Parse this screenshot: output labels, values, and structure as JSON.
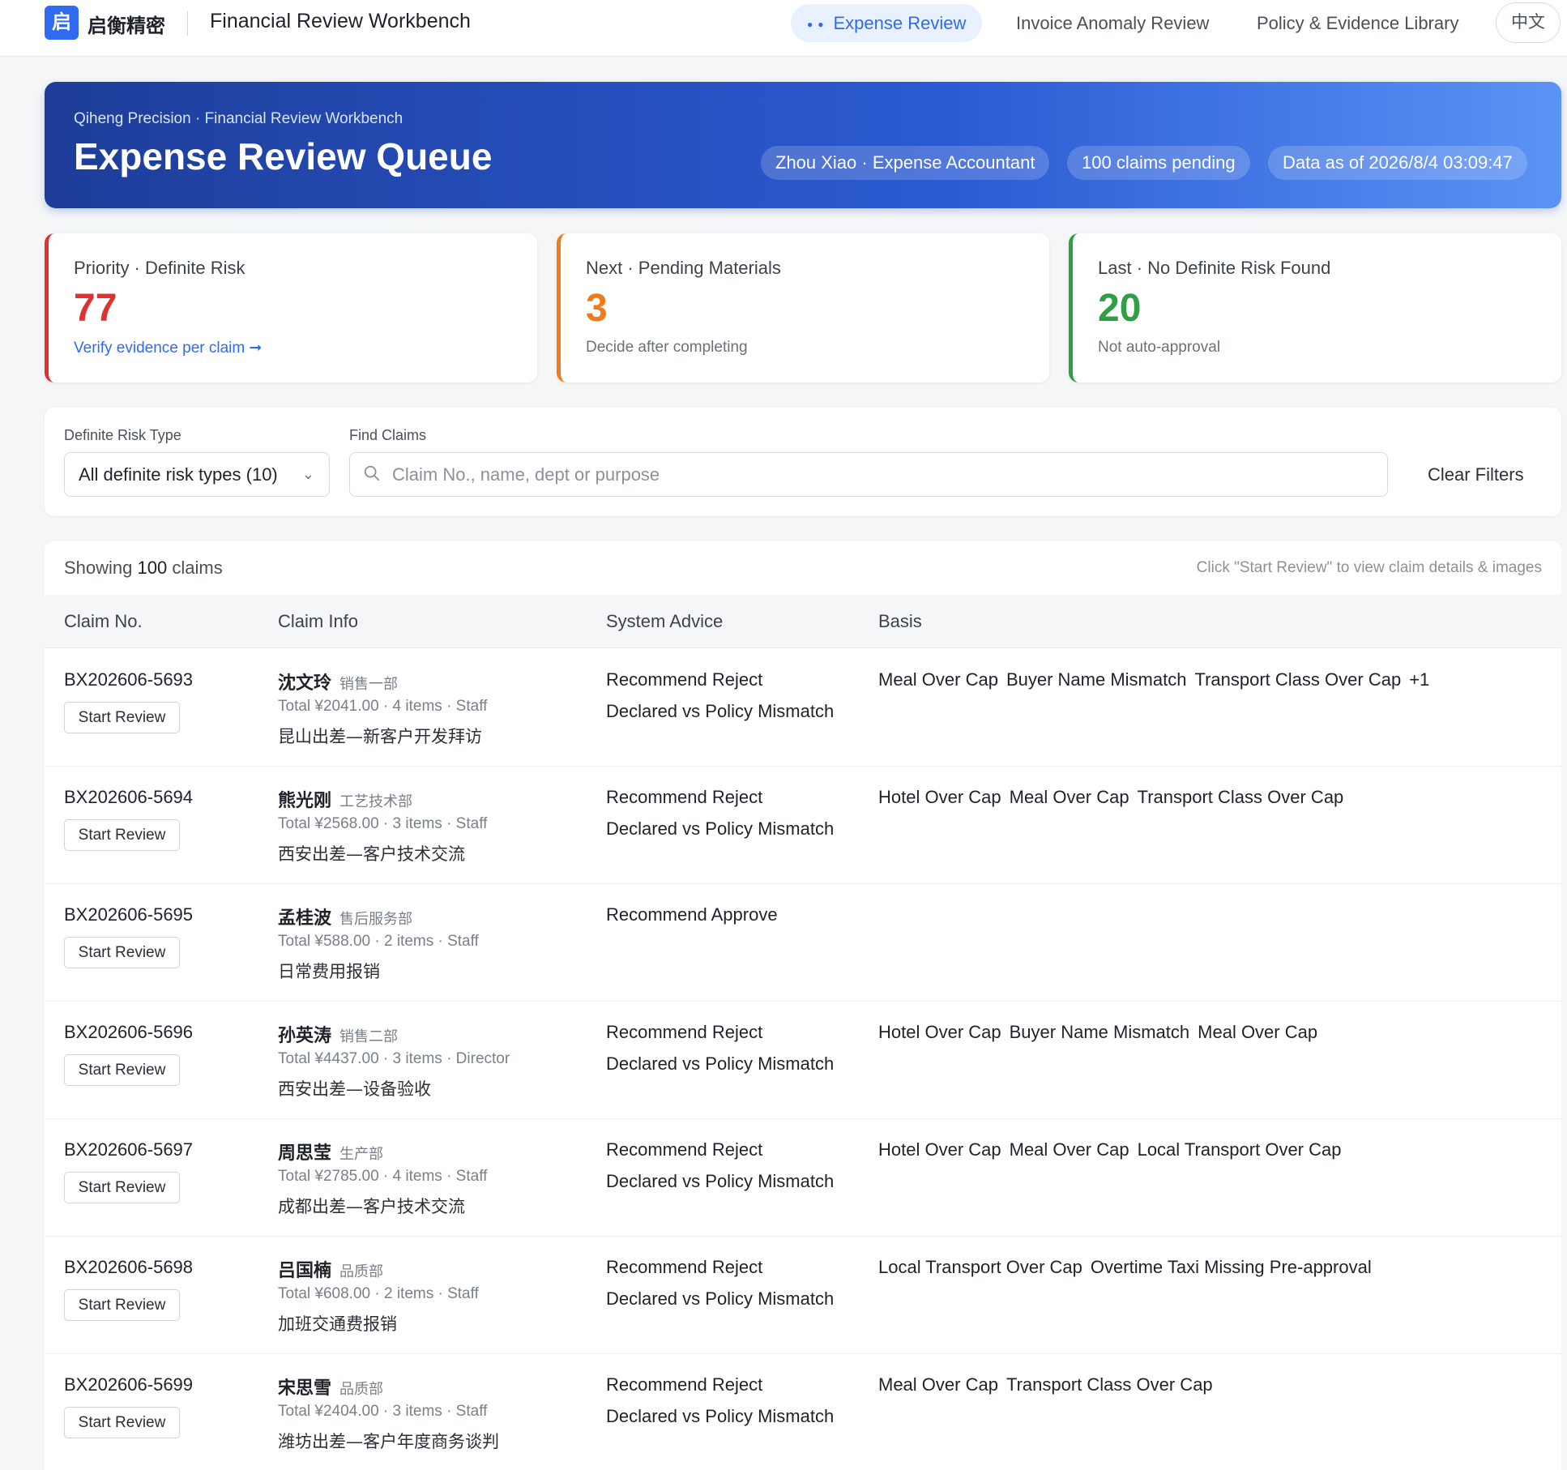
{
  "topbar": {
    "logo_char": "启",
    "brand": "启衡精密",
    "app_title": "Financial Review Workbench",
    "tabs": [
      {
        "label": "Expense Review",
        "active": true
      },
      {
        "label": "Invoice Anomaly Review",
        "active": false
      },
      {
        "label": "Policy & Evidence Library",
        "active": false
      }
    ],
    "language": "中文"
  },
  "hero": {
    "subtitle": "Qiheng Precision · Financial Review Workbench",
    "title": "Expense Review Queue",
    "user": "Zhou Xiao · Expense Accountant",
    "pending": "100 claims pending",
    "data_as_of": "Data as of 2026/8/4 03:09:47"
  },
  "stats": [
    {
      "label": "Priority · Definite Risk",
      "value": "77",
      "note": "Verify evidence per claim ➞",
      "color": "#e03131",
      "note_is_link": true
    },
    {
      "label": "Next · Pending Materials",
      "value": "3",
      "note": "Decide after completing",
      "color": "#f27a1a",
      "note_is_link": false
    },
    {
      "label": "Last · No Definite Risk Found",
      "value": "20",
      "note": "Not auto-approval",
      "color": "#2f9e44",
      "note_is_link": false
    }
  ],
  "filters": {
    "risk_label": "Definite Risk Type",
    "risk_value": "All definite risk types (10)",
    "search_label": "Find Claims",
    "search_placeholder": "Claim No., name, dept or purpose",
    "search_value": "",
    "clear_label": "Clear Filters"
  },
  "table": {
    "showing_prefix": "Showing",
    "showing_count": "100",
    "showing_suffix": "claims",
    "hint": "Click \"Start Review\" to view claim details & images",
    "columns": [
      "Claim No.",
      "Claim Info",
      "System Advice",
      "Basis"
    ],
    "start_label": "Start Review",
    "rows": [
      {
        "claim_no": "BX202606-5693",
        "name": "沈文玲",
        "dept": "销售一部",
        "meta": "Total ¥2041.00 · 4 items · Staff",
        "purpose": "昆山出差—新客户开发拜访",
        "advice": "Recommend Reject",
        "advice2": "Declared vs Policy Mismatch",
        "basis": [
          "Meal Over Cap",
          "Buyer Name Mismatch",
          "Transport Class Over Cap",
          "+1"
        ]
      },
      {
        "claim_no": "BX202606-5694",
        "name": "熊光刚",
        "dept": "工艺技术部",
        "meta": "Total ¥2568.00 · 3 items · Staff",
        "purpose": "西安出差—客户技术交流",
        "advice": "Recommend Reject",
        "advice2": "Declared vs Policy Mismatch",
        "basis": [
          "Hotel Over Cap",
          "Meal Over Cap",
          "Transport Class Over Cap"
        ]
      },
      {
        "claim_no": "BX202606-5695",
        "name": "孟桂波",
        "dept": "售后服务部",
        "meta": "Total ¥588.00 · 2 items · Staff",
        "purpose": "日常费用报销",
        "advice": "Recommend Approve",
        "advice2": "",
        "basis": []
      },
      {
        "claim_no": "BX202606-5696",
        "name": "孙英涛",
        "dept": "销售二部",
        "meta": "Total ¥4437.00 · 3 items · Director",
        "purpose": "西安出差—设备验收",
        "advice": "Recommend Reject",
        "advice2": "Declared vs Policy Mismatch",
        "basis": [
          "Hotel Over Cap",
          "Buyer Name Mismatch",
          "Meal Over Cap"
        ]
      },
      {
        "claim_no": "BX202606-5697",
        "name": "周思莹",
        "dept": "生产部",
        "meta": "Total ¥2785.00 · 4 items · Staff",
        "purpose": "成都出差—客户技术交流",
        "advice": "Recommend Reject",
        "advice2": "Declared vs Policy Mismatch",
        "basis": [
          "Hotel Over Cap",
          "Meal Over Cap",
          "Local Transport Over Cap"
        ]
      },
      {
        "claim_no": "BX202606-5698",
        "name": "吕国楠",
        "dept": "品质部",
        "meta": "Total ¥608.00 · 2 items · Staff",
        "purpose": "加班交通费报销",
        "advice": "Recommend Reject",
        "advice2": "Declared vs Policy Mismatch",
        "basis": [
          "Local Transport Over Cap",
          "Overtime Taxi Missing Pre-approval"
        ]
      },
      {
        "claim_no": "BX202606-5699",
        "name": "宋思雪",
        "dept": "品质部",
        "meta": "Total ¥2404.00 · 3 items · Staff",
        "purpose": "潍坊出差—客户年度商务谈判",
        "advice": "Recommend Reject",
        "advice2": "Declared vs Policy Mismatch",
        "basis": [
          "Meal Over Cap",
          "Transport Class Over Cap"
        ]
      }
    ]
  }
}
